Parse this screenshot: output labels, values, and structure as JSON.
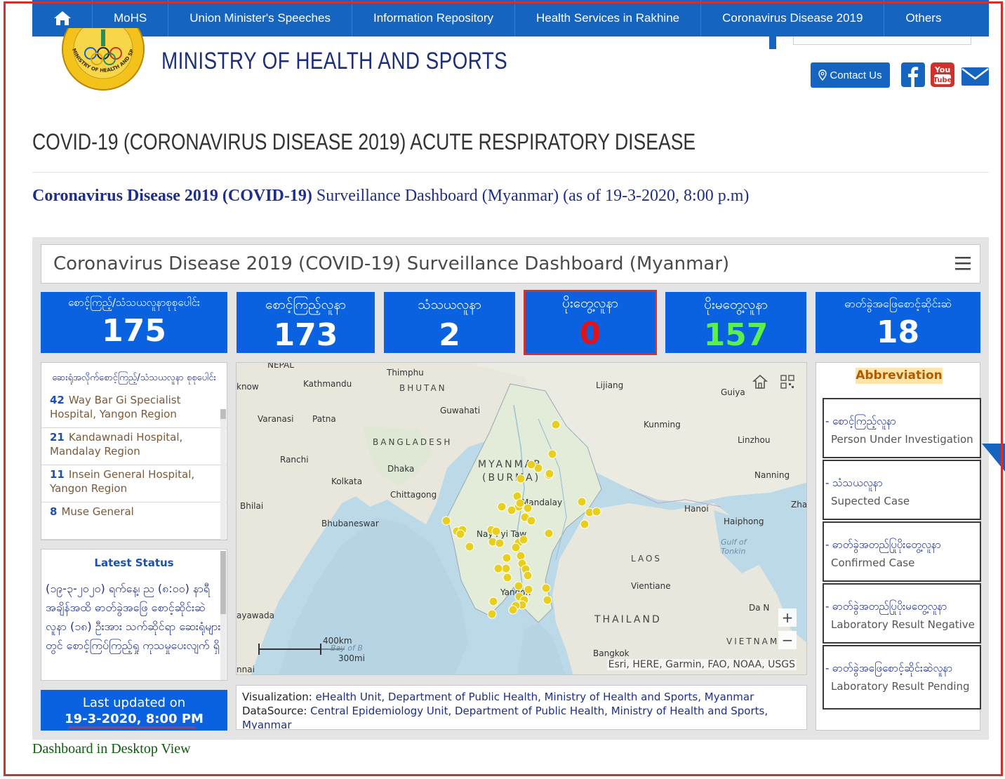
{
  "nav": {
    "items": [
      "MoHS",
      "Union Minister's Speeches",
      "Information Repository",
      "Health Services in Rakhine",
      "Coronavirus Disease 2019",
      "Others"
    ]
  },
  "header": {
    "site_title": "MINISTRY OF HEALTH AND SPORTS",
    "contact_label": "Contact Us",
    "logo_text": "MINISTRY OF HEALTH AND SPORTS"
  },
  "page": {
    "heading": "COVID-19 (CORONAVIRUS DISEASE 2019) ACUTE RESPIRATORY DISEASE",
    "subheading_a": "Coronavirus Disease 2019 (COVID-19)",
    "subheading_b": " Surveillance Dashboard (Myanmar) (as of 19-3-2020, 8:00 p.m)",
    "desktop_link": "Dashboard in Desktop View"
  },
  "dashboard": {
    "title": "Coronavirus Disease 2019 (COVID-19) Surveillance Dashboard (Myanmar)",
    "stats": [
      {
        "label": "စောင့်ကြည့်/သံသယလူနာစုစုပေါင်း",
        "value": "175"
      },
      {
        "label": "စောင့်ကြည့်လူနာ",
        "value": "173"
      },
      {
        "label": "သံသယလူနာ",
        "value": "2"
      },
      {
        "label": "ပိုးတွေ့လူနာ",
        "value": "0"
      },
      {
        "label": "ပိုးမတွေ့လူနာ",
        "value": "157"
      },
      {
        "label": "ဓာတ်ခွဲအဖြေစောင့်ဆိုင်းဆဲ",
        "value": "18"
      }
    ],
    "hospital_panel": {
      "heading": "ဆေးရုံအလိုက်စောင့်ကြည့်/သံသယလူနာ စုစုပေါင်း",
      "items": [
        {
          "count": "42",
          "name": "Way Bar Gi Specialist Hospital, Yangon Region"
        },
        {
          "count": "21",
          "name": "Kandawnadi Hospital, Mandalay Region"
        },
        {
          "count": "11",
          "name": "Insein General Hospital, Yangon Region"
        },
        {
          "count": "8",
          "name": "Muse General"
        }
      ]
    },
    "status": {
      "title": "Latest Status",
      "text": "(၁၉-၃-၂၀၂၀) ရက်နေ့၊ ည (၈:၀၀) နာရီအချိန်အထိ ဓာတ်ခွဲအဖြေ စောင့်ဆိုင်းဆဲ လူနာ (၁၈) ဦးအား သက်ဆိုင်ရာ ဆေးရုံများတွင် စောင့်ကြပ်ကြည့်ရှု ကုသမှုပေးလျက် ရှိ"
    },
    "updated": {
      "line1": "Last updated on",
      "line2": "19-3-2020, 8:00 PM"
    },
    "map": {
      "labels": {
        "nepal": "NEPAL",
        "know": "know",
        "kathmandu": "Kathmandu",
        "thimphu": "Thimphu",
        "bhutan": "BHUTAN",
        "lijiang": "Lijiang",
        "guiyang": "Guiya",
        "guwahati": "Guwahati",
        "varanasi": "Varanasi",
        "patna": "Patna",
        "kunming": "Kunming",
        "bangladesh": "BANGLADESH",
        "linzhou": "Linzhou",
        "ranchi": "Ranchi",
        "dhaka": "Dhaka",
        "myanmar": "MYANMAR",
        "burma": "(BURMA)",
        "nanning": "Nanning",
        "kolkata": "Kolkata",
        "chittagong": "Chittagong",
        "mandalay": "Mandalay",
        "bhilai": "Bhilai",
        "hanoi": "Hanoi",
        "zha": "Zha",
        "haiphong": "Haiphong",
        "bhubaneswar": "Bhubaneswar",
        "naypyitaw": "Nay Pyi Taw",
        "gulf_tonkin": "Gulf of Tonkin",
        "laos": "LAOS",
        "vientiane": "Vientiane",
        "yangon": "Yangon",
        "ayawada": "ayawada",
        "danang": "Da N",
        "thailand": "THAILAND",
        "vietnam": "VIETNAM",
        "bay": "Bay of B",
        "scale_km": "400km",
        "scale_mi": "300mi",
        "bangkok": "Bangkok",
        "chennai": "nnai"
      },
      "attribution": "Esri, HERE, Garmin, FAO, NOAA, USGS",
      "zoom_in": "+",
      "zoom_out": "−"
    },
    "viz": {
      "label1": "Visualization: ",
      "value1": "eHealth Unit, Department of Public Health, Ministry of Health and Sports, Myanmar",
      "label2": "DataSource: ",
      "value2": "Central Epidemiology Unit, Department of Public Health, Ministry of Health and Sports, Myanmar"
    },
    "abbreviation": {
      "title": "Abbreviation",
      "items": [
        {
          "mm": "- စောင့်ကြည့်လူနာ",
          "en": "Person Under Investigation"
        },
        {
          "mm": "- သံသယလူနာ",
          "en": "Supected Case"
        },
        {
          "mm": "- ဓာတ်ခွဲအတည်ပြုပိုးတွေ့လူနာ",
          "en": "Confirmed Case"
        },
        {
          "mm": "- ဓာတ်ခွဲအတည်ပြုပိုးမတွေ့လူနာ",
          "en": "Laboratory Result Negative"
        },
        {
          "mm": "- ဓာတ်ခွဲအဖြေစောင့်ဆိုင်းဆဲလူနာ",
          "en": "Laboratory Result Pending"
        }
      ]
    }
  },
  "colors": {
    "nav_blue": "#1565c0",
    "stat_blue": "#0a62e0",
    "highlight_red": "#d0312d",
    "negative_green": "#5cf04a",
    "confirmed_red": "#e0131b",
    "case_dot": "#e8cf1e"
  },
  "icons": {
    "home": "home-icon",
    "contact": "location-pin-icon",
    "facebook": "facebook-icon",
    "youtube": "youtube-icon",
    "mail": "mail-icon",
    "menu": "hamburger-menu-icon",
    "map_home": "map-home-icon",
    "qr": "qr-code-icon"
  }
}
